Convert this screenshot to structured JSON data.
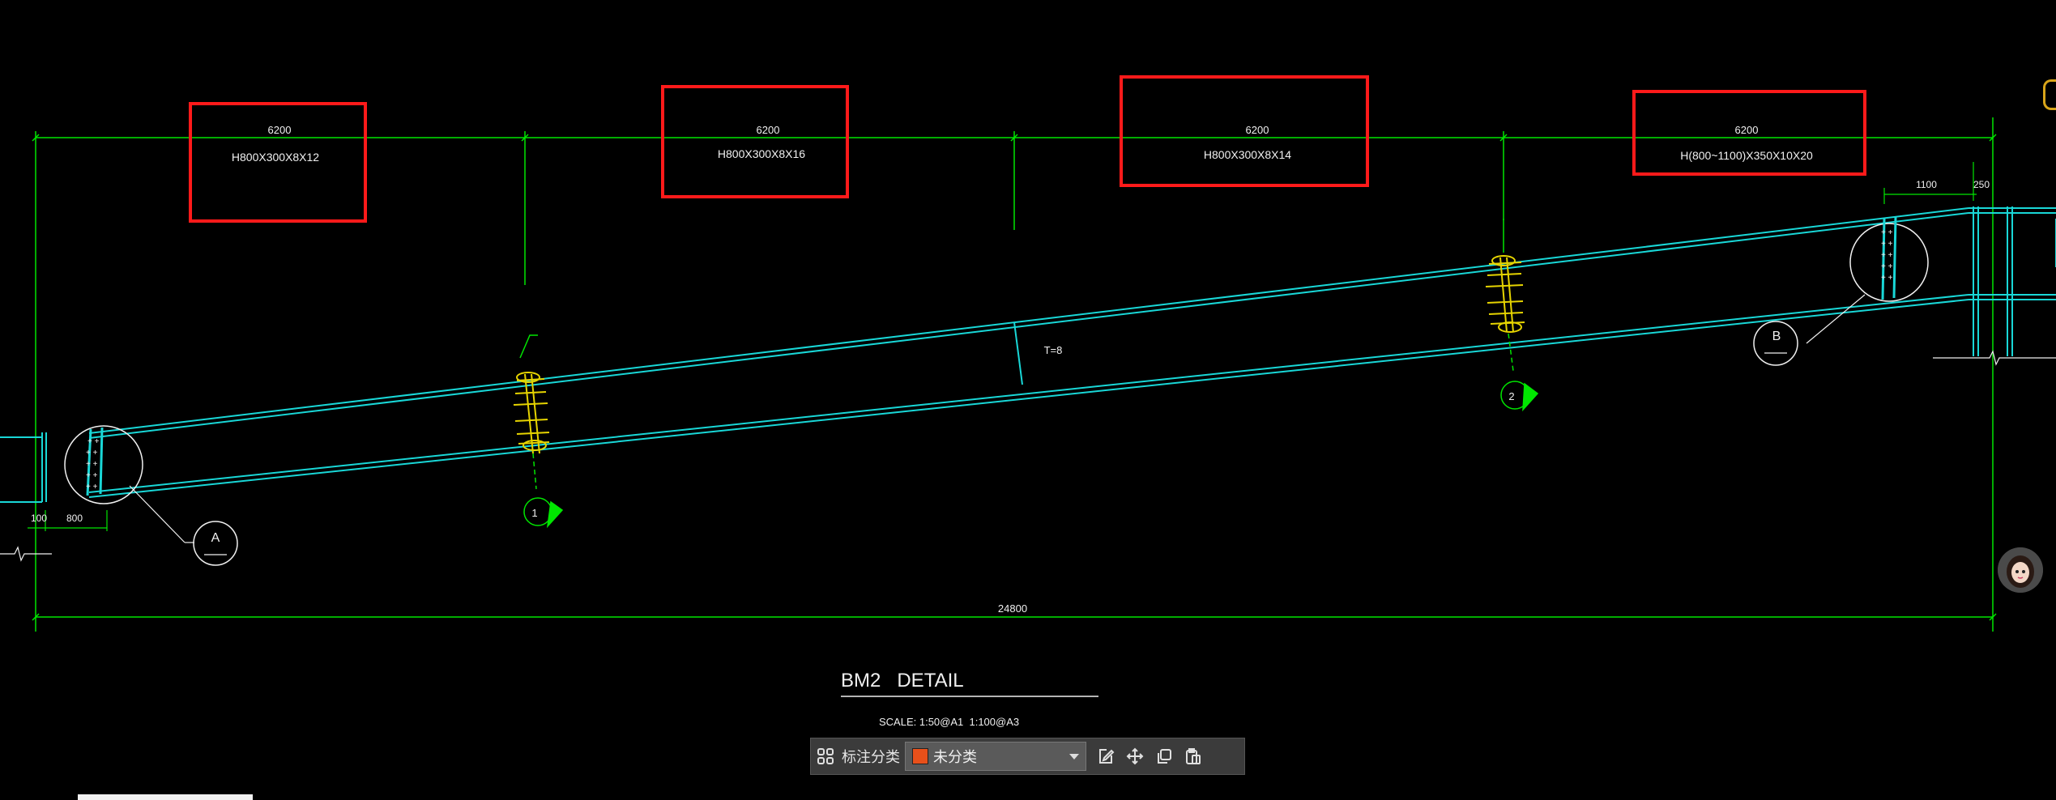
{
  "drawing": {
    "segment_spans": [
      "6200",
      "6200",
      "6200",
      "6200"
    ],
    "section_labels": [
      "H800X300X8X12",
      "H800X300X8X16",
      "H800X300X8X14",
      "H(800~1100)X350X10X20"
    ],
    "total_span": "24800",
    "right_dim_1": "1100",
    "right_dim_2": "250",
    "left_dim_1": "100",
    "left_dim_2": "800",
    "plate_label": "T=8",
    "detail_A": "A",
    "detail_B": "B",
    "section_mark_1": "1",
    "section_mark_2": "2",
    "title": "BM2   DETAIL",
    "scale": "SCALE: 1:50@A1  1:100@A3"
  },
  "toolbar": {
    "label": "标注分类",
    "select_value": "未分类",
    "swatch_color": "#e8501a"
  },
  "colors": {
    "dimension": "#00e600",
    "beam": "#19d7d7",
    "bolt": "#e6d400",
    "highlight": "#ff1a1a",
    "text": "#f0f0f0"
  }
}
